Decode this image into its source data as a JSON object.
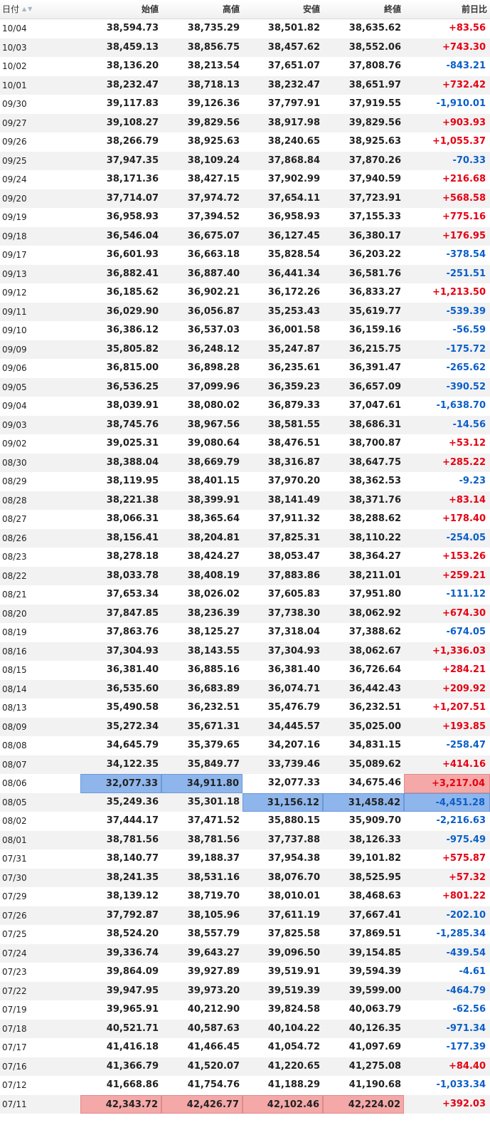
{
  "header": {
    "date": "日付",
    "open": "始値",
    "high": "高値",
    "low": "安値",
    "close": "終値",
    "change": "前日比",
    "sort_up": "▲",
    "sort_down": "▼"
  },
  "colors": {
    "positive": "#e60012",
    "negative": "#0b5fc9",
    "highlight_low": "#8fb6ec",
    "highlight_high": "#f4a8a8",
    "row_alt": "#f2f2f2"
  },
  "rows": [
    {
      "date": "10/04",
      "open": "38,594.73",
      "high": "38,735.29",
      "low": "38,501.82",
      "close": "38,635.62",
      "change": "+83.56"
    },
    {
      "date": "10/03",
      "open": "38,459.13",
      "high": "38,856.75",
      "low": "38,457.62",
      "close": "38,552.06",
      "change": "+743.30"
    },
    {
      "date": "10/02",
      "open": "38,136.20",
      "high": "38,213.54",
      "low": "37,651.07",
      "close": "37,808.76",
      "change": "-843.21"
    },
    {
      "date": "10/01",
      "open": "38,232.47",
      "high": "38,718.13",
      "low": "38,232.47",
      "close": "38,651.97",
      "change": "+732.42"
    },
    {
      "date": "09/30",
      "open": "39,117.83",
      "high": "39,126.36",
      "low": "37,797.91",
      "close": "37,919.55",
      "change": "-1,910.01"
    },
    {
      "date": "09/27",
      "open": "39,108.27",
      "high": "39,829.56",
      "low": "38,917.98",
      "close": "39,829.56",
      "change": "+903.93"
    },
    {
      "date": "09/26",
      "open": "38,266.79",
      "high": "38,925.63",
      "low": "38,240.65",
      "close": "38,925.63",
      "change": "+1,055.37"
    },
    {
      "date": "09/25",
      "open": "37,947.35",
      "high": "38,109.24",
      "low": "37,868.84",
      "close": "37,870.26",
      "change": "-70.33"
    },
    {
      "date": "09/24",
      "open": "38,171.36",
      "high": "38,427.15",
      "low": "37,902.99",
      "close": "37,940.59",
      "change": "+216.68"
    },
    {
      "date": "09/20",
      "open": "37,714.07",
      "high": "37,974.72",
      "low": "37,654.11",
      "close": "37,723.91",
      "change": "+568.58"
    },
    {
      "date": "09/19",
      "open": "36,958.93",
      "high": "37,394.52",
      "low": "36,958.93",
      "close": "37,155.33",
      "change": "+775.16"
    },
    {
      "date": "09/18",
      "open": "36,546.04",
      "high": "36,675.07",
      "low": "36,127.45",
      "close": "36,380.17",
      "change": "+176.95"
    },
    {
      "date": "09/17",
      "open": "36,601.93",
      "high": "36,663.18",
      "low": "35,828.54",
      "close": "36,203.22",
      "change": "-378.54"
    },
    {
      "date": "09/13",
      "open": "36,882.41",
      "high": "36,887.40",
      "low": "36,441.34",
      "close": "36,581.76",
      "change": "-251.51"
    },
    {
      "date": "09/12",
      "open": "36,185.62",
      "high": "36,902.21",
      "low": "36,172.26",
      "close": "36,833.27",
      "change": "+1,213.50"
    },
    {
      "date": "09/11",
      "open": "36,029.90",
      "high": "36,056.87",
      "low": "35,253.43",
      "close": "35,619.77",
      "change": "-539.39"
    },
    {
      "date": "09/10",
      "open": "36,386.12",
      "high": "36,537.03",
      "low": "36,001.58",
      "close": "36,159.16",
      "change": "-56.59"
    },
    {
      "date": "09/09",
      "open": "35,805.82",
      "high": "36,248.12",
      "low": "35,247.87",
      "close": "36,215.75",
      "change": "-175.72"
    },
    {
      "date": "09/06",
      "open": "36,815.00",
      "high": "36,898.28",
      "low": "36,235.61",
      "close": "36,391.47",
      "change": "-265.62"
    },
    {
      "date": "09/05",
      "open": "36,536.25",
      "high": "37,099.96",
      "low": "36,359.23",
      "close": "36,657.09",
      "change": "-390.52"
    },
    {
      "date": "09/04",
      "open": "38,039.91",
      "high": "38,080.02",
      "low": "36,879.33",
      "close": "37,047.61",
      "change": "-1,638.70"
    },
    {
      "date": "09/03",
      "open": "38,745.76",
      "high": "38,967.56",
      "low": "38,581.55",
      "close": "38,686.31",
      "change": "-14.56"
    },
    {
      "date": "09/02",
      "open": "39,025.31",
      "high": "39,080.64",
      "low": "38,476.51",
      "close": "38,700.87",
      "change": "+53.12"
    },
    {
      "date": "08/30",
      "open": "38,388.04",
      "high": "38,669.79",
      "low": "38,316.87",
      "close": "38,647.75",
      "change": "+285.22"
    },
    {
      "date": "08/29",
      "open": "38,119.95",
      "high": "38,401.15",
      "low": "37,970.20",
      "close": "38,362.53",
      "change": "-9.23"
    },
    {
      "date": "08/28",
      "open": "38,221.38",
      "high": "38,399.91",
      "low": "38,141.49",
      "close": "38,371.76",
      "change": "+83.14"
    },
    {
      "date": "08/27",
      "open": "38,066.31",
      "high": "38,365.64",
      "low": "37,911.32",
      "close": "38,288.62",
      "change": "+178.40"
    },
    {
      "date": "08/26",
      "open": "38,156.41",
      "high": "38,204.81",
      "low": "37,825.31",
      "close": "38,110.22",
      "change": "-254.05"
    },
    {
      "date": "08/23",
      "open": "38,278.18",
      "high": "38,424.27",
      "low": "38,053.47",
      "close": "38,364.27",
      "change": "+153.26"
    },
    {
      "date": "08/22",
      "open": "38,033.78",
      "high": "38,408.19",
      "low": "37,883.86",
      "close": "38,211.01",
      "change": "+259.21"
    },
    {
      "date": "08/21",
      "open": "37,653.34",
      "high": "38,026.02",
      "low": "37,605.83",
      "close": "37,951.80",
      "change": "-111.12"
    },
    {
      "date": "08/20",
      "open": "37,847.85",
      "high": "38,236.39",
      "low": "37,738.30",
      "close": "38,062.92",
      "change": "+674.30"
    },
    {
      "date": "08/19",
      "open": "37,863.76",
      "high": "38,125.27",
      "low": "37,318.04",
      "close": "37,388.62",
      "change": "-674.05"
    },
    {
      "date": "08/16",
      "open": "37,304.93",
      "high": "38,143.55",
      "low": "37,304.93",
      "close": "38,062.67",
      "change": "+1,336.03"
    },
    {
      "date": "08/15",
      "open": "36,381.40",
      "high": "36,885.16",
      "low": "36,381.40",
      "close": "36,726.64",
      "change": "+284.21"
    },
    {
      "date": "08/14",
      "open": "36,535.60",
      "high": "36,683.89",
      "low": "36,074.71",
      "close": "36,442.43",
      "change": "+209.92"
    },
    {
      "date": "08/13",
      "open": "35,490.58",
      "high": "36,232.51",
      "low": "35,476.79",
      "close": "36,232.51",
      "change": "+1,207.51"
    },
    {
      "date": "08/09",
      "open": "35,272.34",
      "high": "35,671.31",
      "low": "34,445.57",
      "close": "35,025.00",
      "change": "+193.85"
    },
    {
      "date": "08/08",
      "open": "34,645.79",
      "high": "35,379.65",
      "low": "34,207.16",
      "close": "34,831.15",
      "change": "-258.47"
    },
    {
      "date": "08/07",
      "open": "34,122.35",
      "high": "35,849.77",
      "low": "33,739.46",
      "close": "35,089.62",
      "change": "+414.16"
    },
    {
      "date": "08/06",
      "open": "32,077.33",
      "high": "34,911.80",
      "low": "32,077.33",
      "close": "34,675.46",
      "change": "+3,217.04",
      "hl": {
        "open": "blue",
        "high": "blue",
        "change": "red"
      }
    },
    {
      "date": "08/05",
      "open": "35,249.36",
      "high": "35,301.18",
      "low": "31,156.12",
      "close": "31,458.42",
      "change": "-4,451.28",
      "hl": {
        "low": "blue",
        "close": "blue",
        "change": "blue"
      }
    },
    {
      "date": "08/02",
      "open": "37,444.17",
      "high": "37,471.52",
      "low": "35,880.15",
      "close": "35,909.70",
      "change": "-2,216.63"
    },
    {
      "date": "08/01",
      "open": "38,781.56",
      "high": "38,781.56",
      "low": "37,737.88",
      "close": "38,126.33",
      "change": "-975.49"
    },
    {
      "date": "07/31",
      "open": "38,140.77",
      "high": "39,188.37",
      "low": "37,954.38",
      "close": "39,101.82",
      "change": "+575.87"
    },
    {
      "date": "07/30",
      "open": "38,241.35",
      "high": "38,531.16",
      "low": "38,076.70",
      "close": "38,525.95",
      "change": "+57.32"
    },
    {
      "date": "07/29",
      "open": "38,139.12",
      "high": "38,719.70",
      "low": "38,010.01",
      "close": "38,468.63",
      "change": "+801.22"
    },
    {
      "date": "07/26",
      "open": "37,792.87",
      "high": "38,105.96",
      "low": "37,611.19",
      "close": "37,667.41",
      "change": "-202.10"
    },
    {
      "date": "07/25",
      "open": "38,524.20",
      "high": "38,557.79",
      "low": "37,825.58",
      "close": "37,869.51",
      "change": "-1,285.34"
    },
    {
      "date": "07/24",
      "open": "39,336.74",
      "high": "39,643.27",
      "low": "39,096.50",
      "close": "39,154.85",
      "change": "-439.54"
    },
    {
      "date": "07/23",
      "open": "39,864.09",
      "high": "39,927.89",
      "low": "39,519.91",
      "close": "39,594.39",
      "change": "-4.61"
    },
    {
      "date": "07/22",
      "open": "39,947.95",
      "high": "39,973.20",
      "low": "39,519.39",
      "close": "39,599.00",
      "change": "-464.79"
    },
    {
      "date": "07/19",
      "open": "39,965.91",
      "high": "40,212.90",
      "low": "39,824.58",
      "close": "40,063.79",
      "change": "-62.56"
    },
    {
      "date": "07/18",
      "open": "40,521.71",
      "high": "40,587.63",
      "low": "40,104.22",
      "close": "40,126.35",
      "change": "-971.34"
    },
    {
      "date": "07/17",
      "open": "41,416.18",
      "high": "41,466.45",
      "low": "41,054.72",
      "close": "41,097.69",
      "change": "-177.39"
    },
    {
      "date": "07/16",
      "open": "41,366.79",
      "high": "41,520.07",
      "low": "41,220.65",
      "close": "41,275.08",
      "change": "+84.40"
    },
    {
      "date": "07/12",
      "open": "41,668.86",
      "high": "41,754.76",
      "low": "41,188.29",
      "close": "41,190.68",
      "change": "-1,033.34"
    },
    {
      "date": "07/11",
      "open": "42,343.72",
      "high": "42,426.77",
      "low": "42,102.46",
      "close": "42,224.02",
      "change": "+392.03",
      "hl": {
        "open": "red",
        "high": "red",
        "low": "red",
        "close": "red"
      }
    }
  ]
}
